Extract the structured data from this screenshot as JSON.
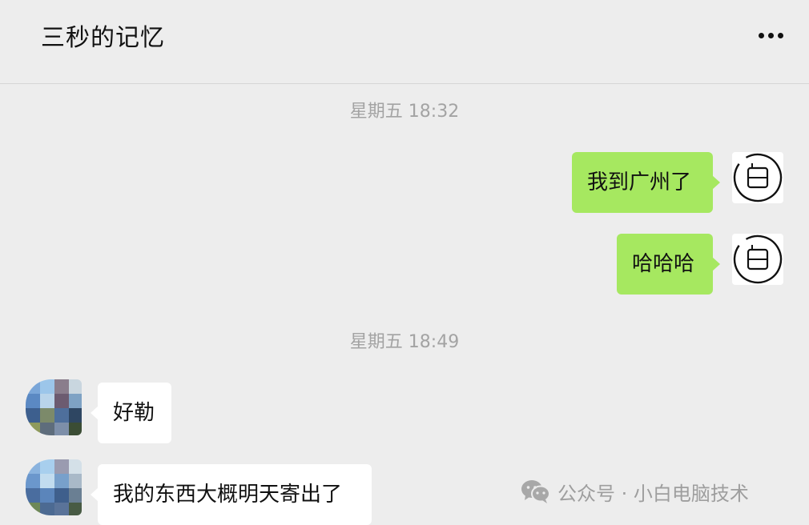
{
  "header": {
    "title": "三秒的记忆",
    "more_icon": "more-dots-icon"
  },
  "messages": [
    {
      "type": "timestamp",
      "text": "星期五 18:32"
    },
    {
      "type": "sent",
      "text": "我到广州了",
      "avatar_icon": "calendar-line-icon"
    },
    {
      "type": "sent",
      "text": "哈哈哈",
      "avatar_icon": "calendar-line-icon"
    },
    {
      "type": "timestamp",
      "text": "星期五 18:49"
    },
    {
      "type": "received",
      "text": "好勒",
      "avatar_icon": "pixelated-photo-avatar"
    },
    {
      "type": "received",
      "text": "我的东西大概明天寄出了",
      "avatar_icon": "pixelated-photo-avatar"
    }
  ],
  "watermark": {
    "icon": "wechat-logo-icon",
    "text": "公众号 · 小白电脑技术"
  },
  "colors": {
    "background": "#ededed",
    "sent_bubble": "#a6e860",
    "received_bubble": "#ffffff",
    "timestamp_text": "#a3a3a3"
  }
}
